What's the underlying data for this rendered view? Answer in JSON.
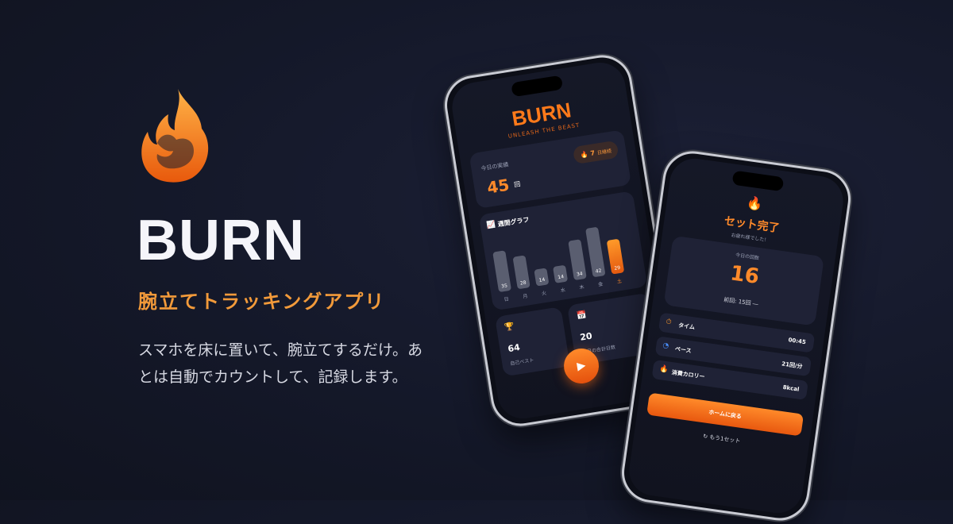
{
  "hero": {
    "brand": "BURN",
    "tagline": "腕立てトラッキングアプリ",
    "description": "スマホを床に置いて、腕立てするだけ。あとは自動でカウントして、記録します。"
  },
  "phone_home": {
    "brand": "BURN",
    "subtitle": "UNLEASH THE BEAST",
    "today": {
      "label": "今日の実績",
      "value": "45",
      "unit": "回"
    },
    "streak": {
      "icon": "🔥",
      "value": "7",
      "unit": "日継続"
    },
    "graph": {
      "title": "週間グラフ",
      "days": [
        "日",
        "月",
        "火",
        "水",
        "木",
        "金",
        "土"
      ],
      "values": [
        35,
        28,
        14,
        14,
        34,
        42,
        29
      ]
    },
    "best": {
      "value": "64",
      "label": "自己ベスト"
    },
    "month_days": {
      "value": "20",
      "label": "今月の合計日数"
    }
  },
  "phone_result": {
    "title": "セット完了",
    "subtitle": "お疲れ様でした！",
    "count_label": "今日の回数",
    "count_value": "16",
    "previous": "前回: 15回 ―",
    "stats": [
      {
        "icon": "⏱",
        "label": "タイム",
        "value": "00:45"
      },
      {
        "icon": "◔",
        "label": "ペース",
        "value": "21回/分"
      },
      {
        "icon": "🔥",
        "label": "消費カロリー",
        "value": "8kcal"
      }
    ],
    "home_button": "ホームに戻る",
    "again_button": "もう1セット"
  },
  "colors": {
    "accent": "#ff8a2a",
    "background": "#141829"
  }
}
